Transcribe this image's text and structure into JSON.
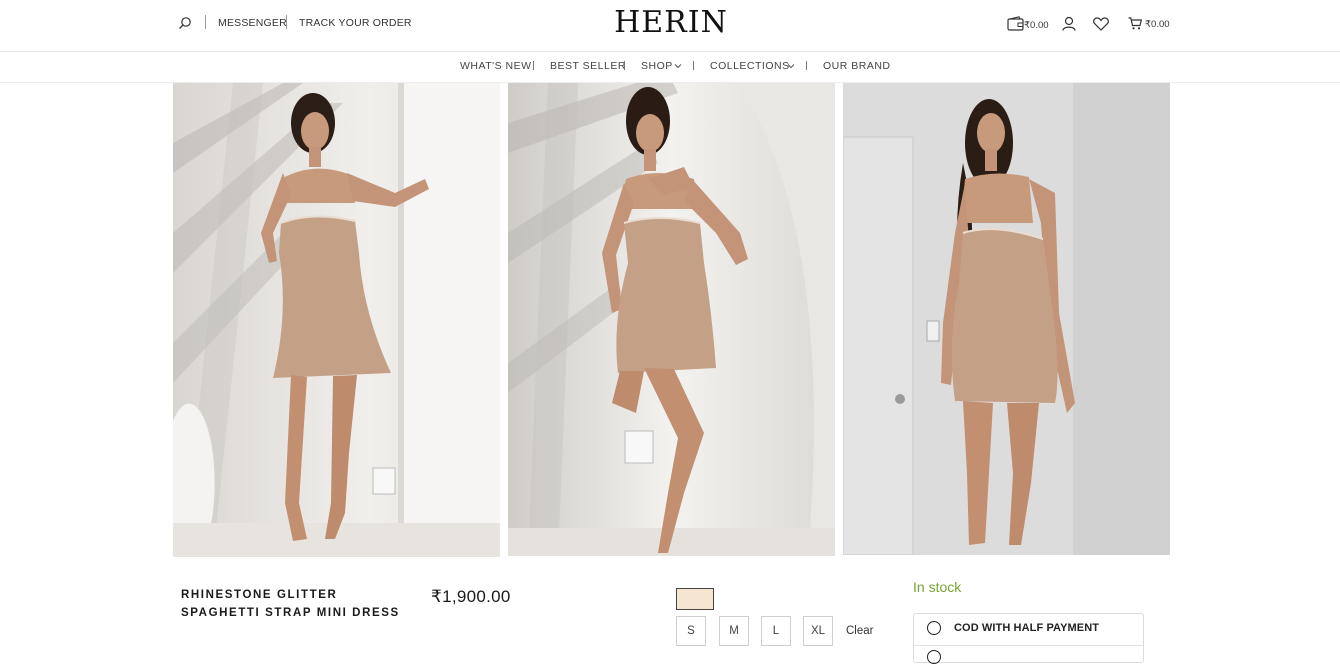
{
  "header": {
    "links": [
      "MESSENGER",
      "TRACK YOUR ORDER"
    ],
    "logo": "HERIN",
    "wallet_amount": "₹0.00",
    "cart_amount": "₹0.00",
    "icons": [
      "search-icon",
      "wallet-icon",
      "user-icon",
      "heart-icon",
      "cart-icon"
    ]
  },
  "nav": {
    "items": [
      "WHAT'S NEW",
      "BEST SELLER",
      "SHOP",
      "COLLECTIONS",
      "OUR BRAND"
    ]
  },
  "gallery": {
    "images": [
      "model-photo-1",
      "model-photo-2",
      "model-photo-3"
    ]
  },
  "product": {
    "name_line1": "RHINESTONE GLITTER",
    "name_line2": "SPAGHETTI STRAP MINI DRESS",
    "price": "₹1,900.00",
    "color_swatch": "#f4e4d0",
    "sizes": [
      "S",
      "M",
      "L",
      "XL"
    ],
    "clear_label": "Clear",
    "stock_status": "In stock",
    "payment_option": "COD WITH HALF PAYMENT"
  },
  "colors": {
    "stock_green": "#77a336",
    "dress": "#c4a086"
  }
}
